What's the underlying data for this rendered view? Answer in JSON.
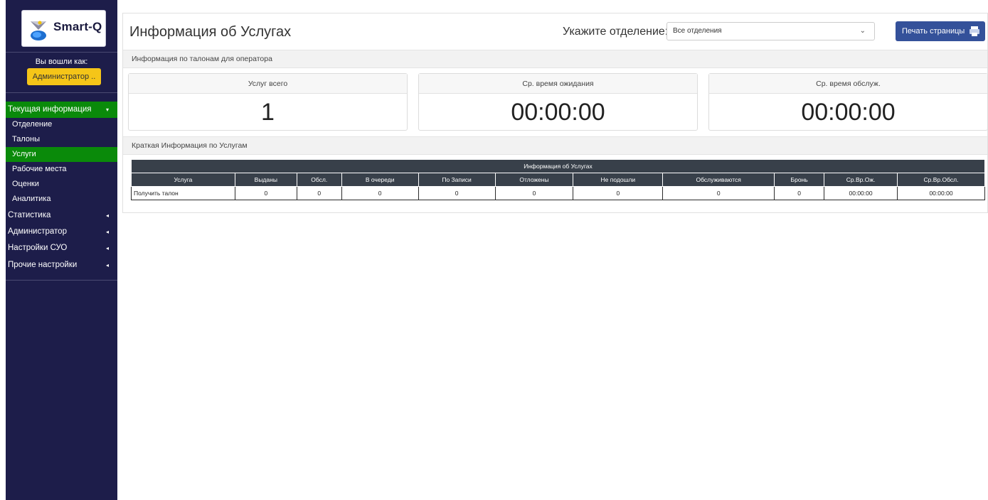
{
  "sidebar": {
    "logo_text": "Smart-Q",
    "login_label": "Вы вошли как:",
    "user_button": "Администратор ..",
    "menu": [
      {
        "label": "Текущая информация",
        "arrow": "▾"
      },
      {
        "label": "Статистика",
        "arrow": "◂"
      },
      {
        "label": "Администратор",
        "arrow": "◂"
      },
      {
        "label": "Настройки СУО",
        "arrow": "◂"
      },
      {
        "label": "Прочие настройки",
        "arrow": "◂"
      }
    ],
    "submenu": [
      "Отделение",
      "Талоны",
      "Услуги",
      "Рабочие места",
      "Оценки",
      "Аналитика"
    ]
  },
  "header": {
    "title": "Информация об Услугах",
    "dept_label": "Укажите отделение:",
    "dept_select_value": "Все отделения",
    "print_button": "Печать страницы"
  },
  "operator_section": {
    "title": "Информация по талонам для оператора",
    "cards": [
      {
        "label": "Услуг всего",
        "value": "1"
      },
      {
        "label": "Ср. время ожидания",
        "value": "00:00:00"
      },
      {
        "label": "Ср. время обслуж.",
        "value": "00:00:00"
      }
    ]
  },
  "summary_section": {
    "title": "Краткая Информация по Услугам",
    "table_caption": "Информация об Услугах",
    "columns": [
      "Услуга",
      "Выданы",
      "Обсл.",
      "В очереди",
      "По Записи",
      "Отложены",
      "Не подошли",
      "Обслуживаются",
      "Бронь",
      "Ср.Вр.Ож.",
      "Ср.Вр.Обсл."
    ],
    "rows": [
      [
        "Получить талон",
        "0",
        "0",
        "0",
        "0",
        "0",
        "0",
        "0",
        "0",
        "00:00:00",
        "00:00:00"
      ]
    ]
  },
  "colors": {
    "sidebar_bg": "#1d1d4a",
    "active_green": "#0a8a0a",
    "user_button_bg": "#f5c518",
    "print_button_bg": "#34519a",
    "table_header_bg": "#38404a"
  },
  "icons": [
    "smart-q-logo-icon",
    "chevron-down-icon",
    "chevron-left-icon",
    "printer-icon"
  ]
}
